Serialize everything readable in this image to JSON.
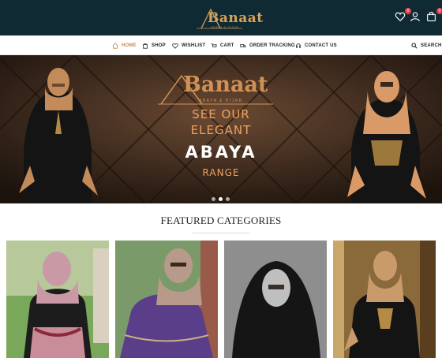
{
  "header": {
    "logo_text": "Banaat",
    "logo_tagline": "ABAYA & HIJAB",
    "wishlist_count": "0",
    "cart_count": "0",
    "icons": [
      "heart-icon",
      "user-icon",
      "bag-icon"
    ]
  },
  "nav": {
    "items": [
      {
        "label": "HOME",
        "icon": "home-icon",
        "active": true
      },
      {
        "label": "SHOP",
        "icon": "bag-icon"
      },
      {
        "label": "WISHLIST",
        "icon": "heart-icon"
      },
      {
        "label": "CART",
        "icon": "cart-icon"
      },
      {
        "label": "ORDER TRACKING",
        "icon": "truck-icon"
      },
      {
        "label": "CONTACT US",
        "icon": "headset-icon"
      }
    ],
    "search_label": "SEARCH"
  },
  "hero": {
    "brand": "Banaat",
    "tagline": "ABAYA & HIJAB",
    "line1": "SEE OUR",
    "line2": "ELEGANT",
    "line3": "ABAYA",
    "line4": "RANGE",
    "slide_count": 3,
    "active_slide": 2
  },
  "featured": {
    "title": "FEATURED CATEGORIES"
  },
  "colors": {
    "header_bg": "#0f2a33",
    "accent": "#c58b4f",
    "badge": "#e8414a"
  }
}
